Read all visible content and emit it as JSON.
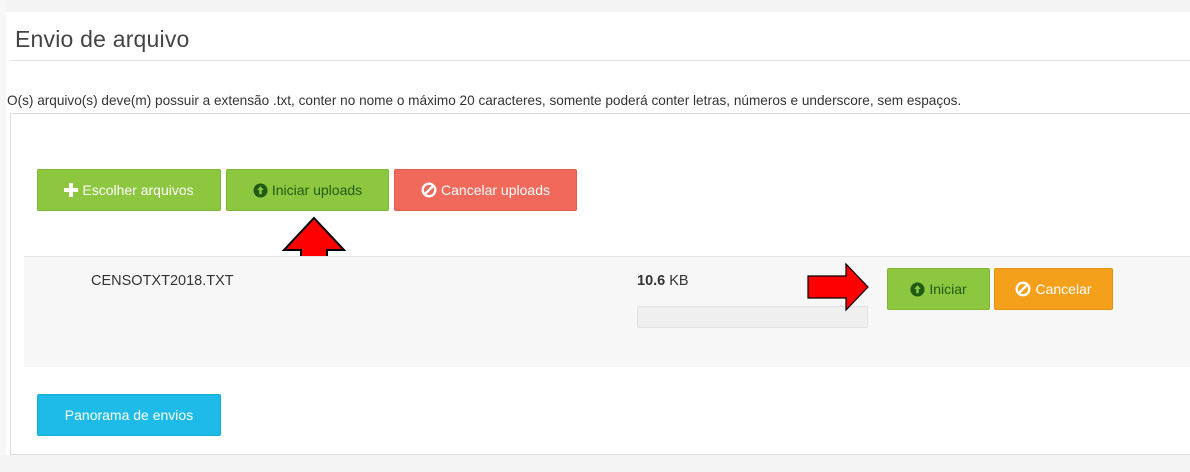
{
  "page": {
    "title": "Envio de arquivo",
    "info": "O(s) arquivo(s) deve(m) possuir a extensão .txt, conter no nome o máximo 20 caracteres, somente poderá conter letras, números e underscore, sem espaços."
  },
  "toolbar": {
    "choose_label": "Escolher arquivos",
    "choose_icon": "plus-icon",
    "start_all_label": "Iniciar uploads",
    "start_all_icon": "upload-circle-icon",
    "cancel_all_label": "Cancelar uploads",
    "cancel_all_icon": "ban-icon"
  },
  "files": [
    {
      "name": "CENSOTXT2018.TXT",
      "size_value": "10.6",
      "size_unit": "KB",
      "progress": 0,
      "start_label": "Iniciar",
      "cancel_label": "Cancelar"
    }
  ],
  "footer": {
    "overview_label": "Panorama de envios"
  },
  "colors": {
    "green": "#8dc63f",
    "red": "#f0695a",
    "orange": "#f5a01a",
    "cyan": "#1ebbe8",
    "annotation_arrow": "#ff0000"
  }
}
